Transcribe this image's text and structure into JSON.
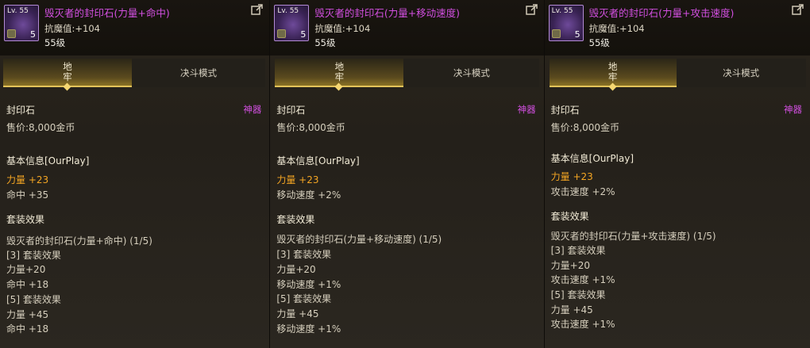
{
  "panels": [
    {
      "item_name": "毁灭者的封印石(力量+命中)",
      "level_badge": "Lv. 55",
      "stack_count": "5",
      "magic_resist": "抗魔值:+104",
      "level": "55级",
      "tabs": [
        "地牢",
        "决斗模式"
      ],
      "category": "封印石",
      "rarity": "神器",
      "price": "售价:8,000金币",
      "basic_title": "基本信息[OurPlay]",
      "stat1": "力量 +23",
      "stat2": "命中 +35",
      "set_title": "套装效果",
      "set_name": "毁灭者的封印石(力量+命中) (1/5)",
      "set3_label": "[3] 套装效果",
      "set3_a": "力量+20",
      "set3_b": "命中 +18",
      "set5_label": "[5] 套装效果",
      "set5_a": "力量 +45",
      "set5_b": "命中 +18"
    },
    {
      "item_name": "毁灭者的封印石(力量+移动速度)",
      "level_badge": "Lv. 55",
      "stack_count": "5",
      "magic_resist": "抗魔值:+104",
      "level": "55级",
      "tabs": [
        "地牢",
        "决斗模式"
      ],
      "category": "封印石",
      "rarity": "神器",
      "price": "售价:8,000金币",
      "basic_title": "基本信息[OurPlay]",
      "stat1": "力量 +23",
      "stat2": "移动速度 +2%",
      "set_title": "套装效果",
      "set_name": "毁灭者的封印石(力量+移动速度) (1/5)",
      "set3_label": "[3] 套装效果",
      "set3_a": "力量+20",
      "set3_b": "移动速度 +1%",
      "set5_label": "[5] 套装效果",
      "set5_a": "力量 +45",
      "set5_b": "移动速度 +1%"
    },
    {
      "item_name": "毁灭者的封印石(力量+攻击速度)",
      "level_badge": "Lv. 55",
      "stack_count": "5",
      "magic_resist": "抗魔值:+104",
      "level": "55级",
      "tabs": [
        "地牢",
        "决斗模式"
      ],
      "category": "封印石",
      "rarity": "神器",
      "price": "售价:8,000金币",
      "basic_title": "基本信息[OurPlay]",
      "stat1": "力量 +23",
      "stat2": "攻击速度 +2%",
      "set_title": "套装效果",
      "set_name": "毁灭者的封印石(力量+攻击速度) (1/5)",
      "set3_label": "[3] 套装效果",
      "set3_a": "力量+20",
      "set3_b": "攻击速度 +1%",
      "set5_label": "[5] 套装效果",
      "set5_a": "力量 +45",
      "set5_b": "攻击速度 +1%"
    }
  ],
  "colors": {
    "item_name": "#d24fe0",
    "rarity": "#d24fe0",
    "primary_stat": "#f5a623",
    "tab_accent": "#e3c25a"
  },
  "icons": {
    "share": "external-link-icon",
    "item": "seal-stone-icon"
  }
}
